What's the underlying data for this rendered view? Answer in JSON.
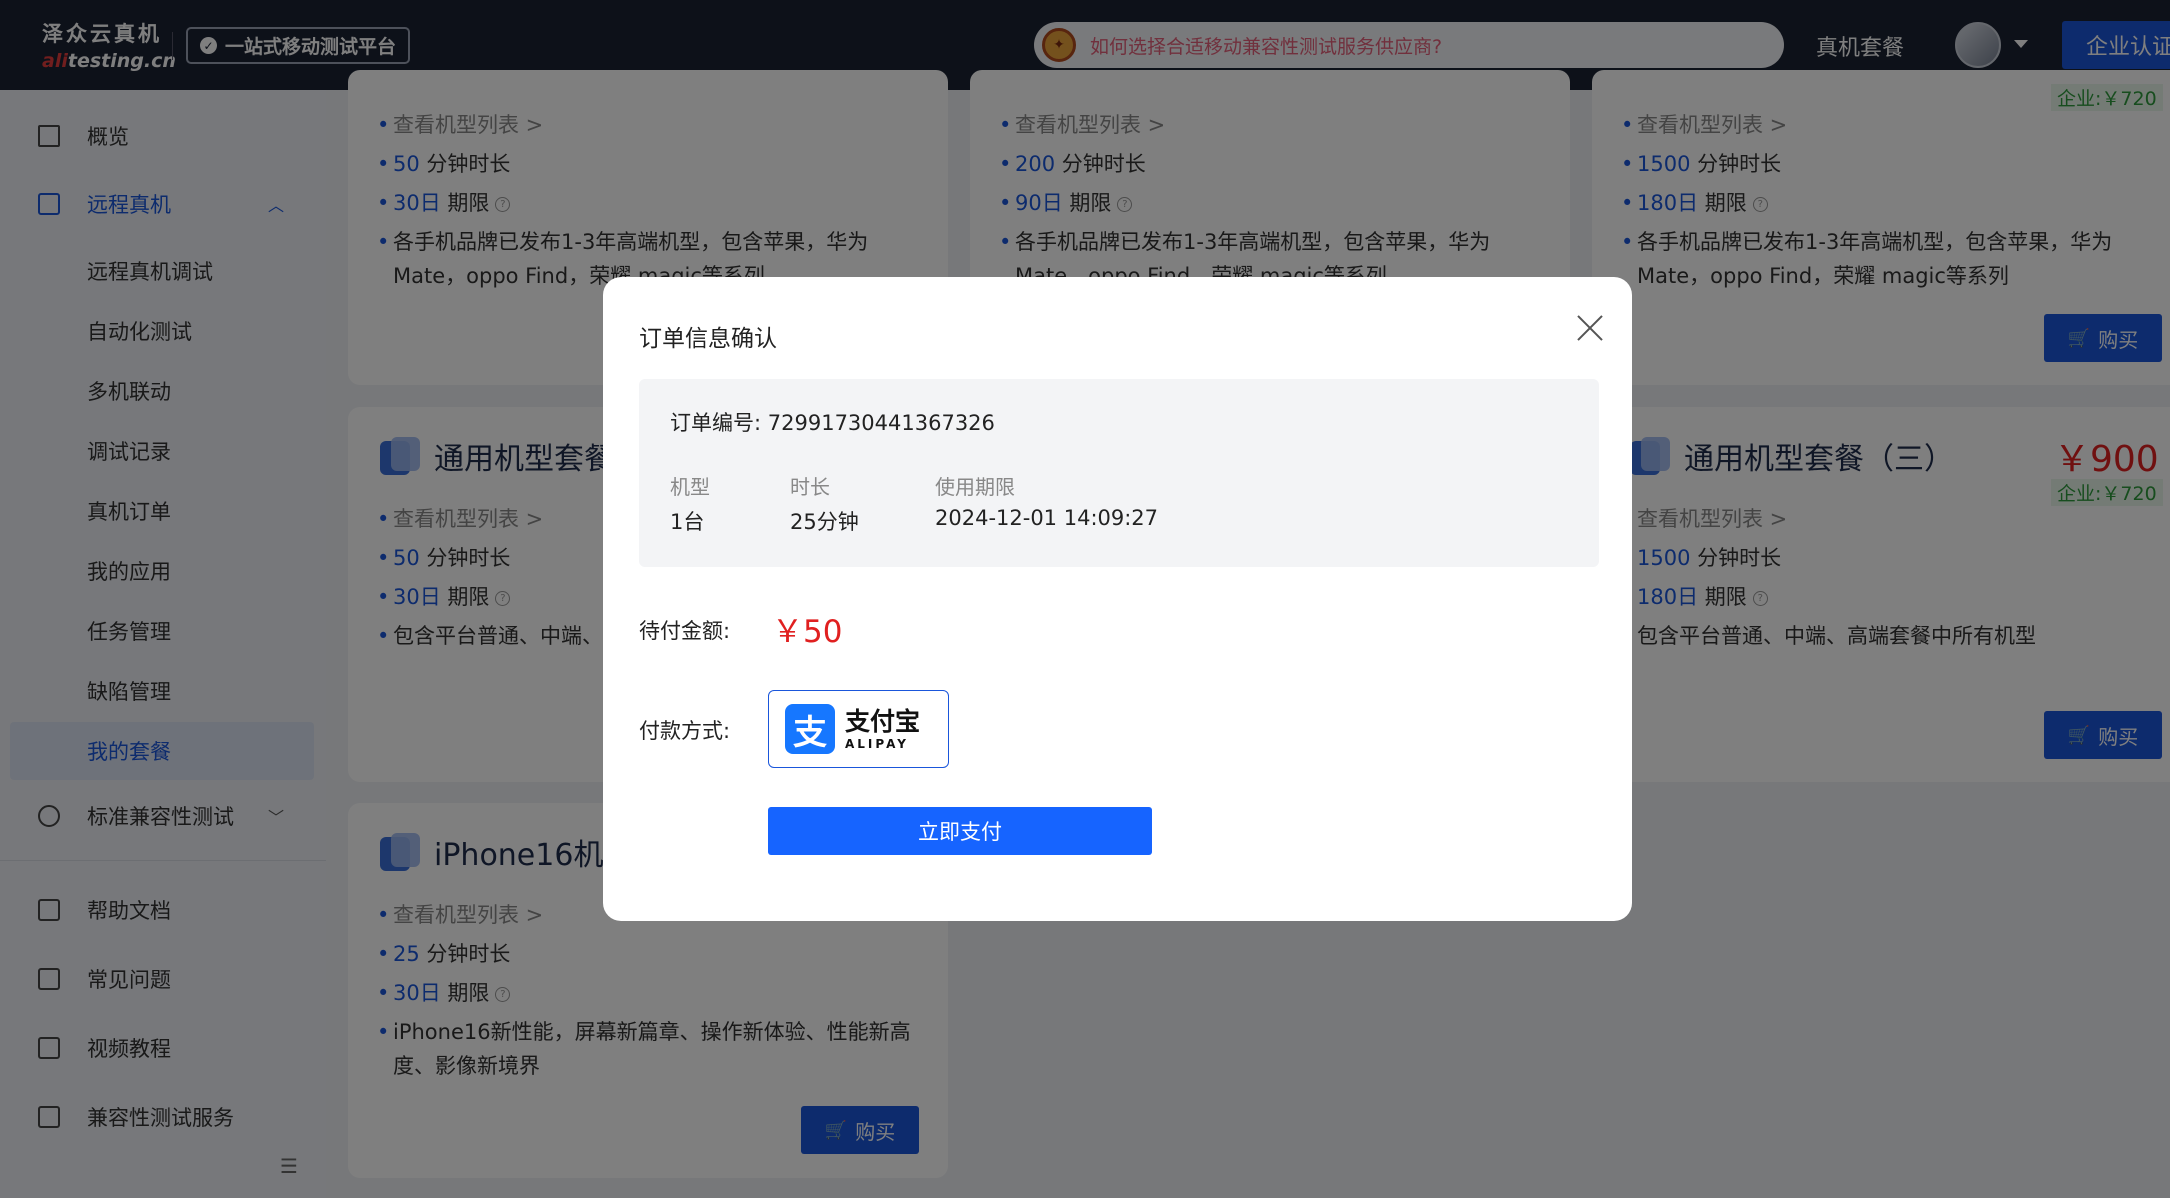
{
  "header": {
    "logo_cn": "泽众云真机",
    "logo_en_prefix": "ali",
    "logo_en_suffix": "testing.cn",
    "platform_badge": "一站式移动测试平台",
    "notice_text": "如何选择合适移动兼容性测试服务供应商?",
    "nav_packages": "真机套餐",
    "enterprise_button": "企业认证"
  },
  "sidebar": {
    "overview": "概览",
    "remote_device": "远程真机",
    "sub_items": [
      "远程真机调试",
      "自动化测试",
      "多机联动",
      "调试记录",
      "真机订单",
      "我的应用",
      "任务管理",
      "缺陷管理",
      "我的套餐"
    ],
    "selected_sub": "我的套餐",
    "standard_compat": "标准兼容性测试",
    "help_docs": "帮助文档",
    "faq": "常见问题",
    "video_tutorials": "视频教程",
    "compat_service": "兼容性测试服务"
  },
  "cards": {
    "top_left": {
      "view_models": "查看机型列表 >",
      "minutes_value": "50",
      "minutes_unit": "分钟时长",
      "period_value": "30日",
      "period_unit": "期限",
      "desc_line1": "各手机品牌已发布1-3年高端机型，包含苹果，华为",
      "desc_line2": "Mate，oppo Find，荣耀 magic等系列"
    },
    "top_middle": {
      "view_models": "查看机型列表 >",
      "minutes_value": "200",
      "minutes_unit": "分钟时长",
      "period_value": "90日",
      "period_unit": "期限",
      "desc_line1": "各手机品牌已发布1-3年高端机型，包含苹果，华为",
      "desc_line2": "Mate，oppo Find，荣耀 magic等系列"
    },
    "top_right": {
      "ent_price": "企业:￥720",
      "view_models": "查看机型列表 >",
      "minutes_value": "1500",
      "minutes_unit": "分钟时长",
      "period_value": "180日",
      "period_unit": "期限",
      "desc_line1": "各手机品牌已发布1-3年高端机型，包含苹果，华为",
      "desc_line2": "Mate，oppo Find，荣耀 magic等系列",
      "buy": "购买"
    },
    "mid_left": {
      "title": "通用机型套餐",
      "view_models": "查看机型列表 >",
      "minutes_value": "50",
      "minutes_unit": "分钟时长",
      "period_value": "30日",
      "period_unit": "期限",
      "desc_line1": "包含平台普通、中端、"
    },
    "mid_right": {
      "title": "通用机型套餐（三）",
      "price": "￥900",
      "ent_price": "企业:￥720",
      "view_models": "查看机型列表 >",
      "minutes_value": "1500",
      "minutes_unit": "分钟时长",
      "period_value": "180日",
      "period_unit": "期限",
      "desc_line1": "包含平台普通、中端、高端套餐中所有机型",
      "buy": "购买"
    },
    "bottom_left": {
      "title": "iPhone16机",
      "view_models": "查看机型列表 >",
      "minutes_value": "25",
      "minutes_unit": "分钟时长",
      "period_value": "30日",
      "period_unit": "期限",
      "desc_line1": "iPhone16新性能，屏幕新篇章、操作新体验、性能新高",
      "desc_line2": "度、影像新境界",
      "buy": "购买"
    }
  },
  "modal": {
    "title": "订单信息确认",
    "order_no_label": "订单编号:",
    "order_no": "72991730441367326",
    "col_device_label": "机型",
    "col_device_value": "1台",
    "col_duration_label": "时长",
    "col_duration_value": "25分钟",
    "col_expiry_label": "使用期限",
    "col_expiry_value": "2024-12-01 14:09:27",
    "amount_label": "待付金额:",
    "amount_value": "￥50",
    "payment_label": "付款方式:",
    "alipay_cn": "支付宝",
    "alipay_en": "ALIPAY",
    "pay_button": "立即支付"
  },
  "colors": {
    "primary": "#1a56db",
    "price_red": "#e02020",
    "topbar": "#1a2233"
  }
}
